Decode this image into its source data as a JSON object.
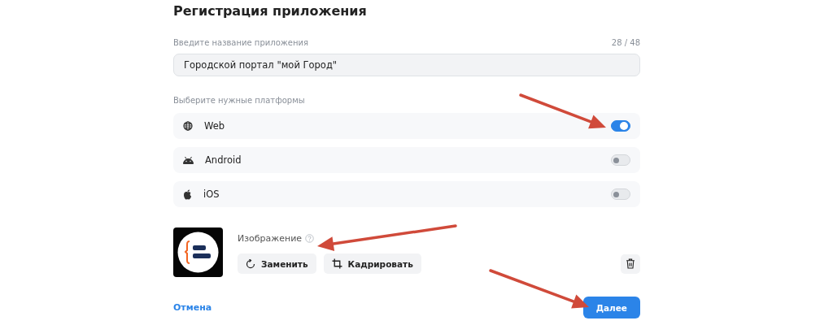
{
  "title": "Регистрация приложения",
  "name_field": {
    "label": "Введите название приложения",
    "counter": "28 / 48",
    "value": "Городской портал \"мой Город\""
  },
  "platforms": {
    "label": "Выберите нужные платформы",
    "items": [
      {
        "kind": "web",
        "name": "Web",
        "on": true
      },
      {
        "kind": "android",
        "name": "Android",
        "on": false
      },
      {
        "kind": "ios",
        "name": "iOS",
        "on": false
      }
    ]
  },
  "image": {
    "label": "Изображение",
    "buttons": [
      {
        "kind": "replace",
        "label": "Заменить"
      },
      {
        "kind": "crop",
        "label": "Кадрировать"
      }
    ]
  },
  "footer": {
    "cancel": "Отмена",
    "next": "Далее"
  }
}
